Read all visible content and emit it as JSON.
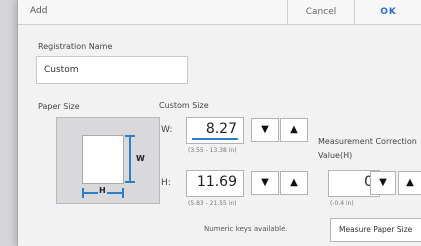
{
  "dialog": {
    "title": "Add",
    "cancel_label": "Cancel",
    "ok_label": "OK"
  },
  "registration": {
    "label": "Registration Name",
    "value": "Custom"
  },
  "paper_size": {
    "label": "Paper Size",
    "w_marker": "W",
    "h_marker": "H"
  },
  "custom_size": {
    "label": "Custom Size",
    "w_label": "W:",
    "w_value": "8.27",
    "w_range": "(3.55 - 13.38 in)",
    "h_label": "H:",
    "h_value": "11.69",
    "h_range": "(5.83 - 21.55 in)",
    "down_icon": "triangle-down-icon",
    "up_icon": "triangle-up-icon"
  },
  "measurement": {
    "label_line1": "Measurement Correction",
    "label_line2": "Value(H)",
    "value": "0",
    "range": "(-0.4 in)"
  },
  "hint": "Numeric keys available.",
  "measure_button": "Measure Paper Size"
}
